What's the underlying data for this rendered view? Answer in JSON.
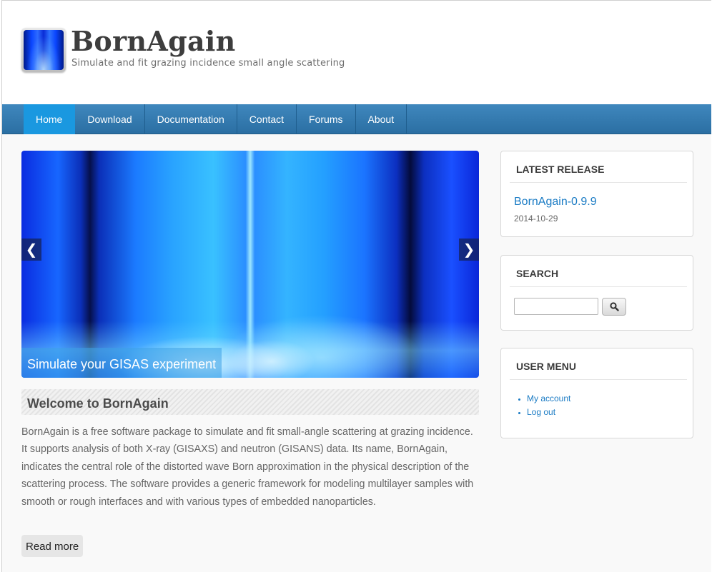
{
  "site": {
    "name": "BornAgain",
    "slogan": "Simulate and fit grazing incidence small angle scattering"
  },
  "nav": {
    "items": [
      "Home",
      "Download",
      "Documentation",
      "Contact",
      "Forums",
      "About"
    ],
    "active": "Home"
  },
  "slider": {
    "caption": "Simulate your GISAS experiment",
    "prev_icon": "chevron-left-icon",
    "next_icon": "chevron-right-icon"
  },
  "article": {
    "title": "Welcome to BornAgain",
    "body": "BornAgain is a free software package to simulate and fit small-angle scattering at grazing incidence. It supports analysis of both X-ray (GISAXS) and neutron (GISANS) data.  Its name, BornAgain, indicates the central role of the distorted wave Born approximation  in the physical description of the scattering process.  The software provides a generic framework for modeling multilayer samples with smooth or rough interfaces and with various types of embedded nanoparticles.",
    "read_more": "Read more"
  },
  "sidebar": {
    "latest_release": {
      "title": "LATEST RELEASE",
      "link": "BornAgain-0.9.9",
      "date": "2014-10-29"
    },
    "search": {
      "title": "SEARCH",
      "value": "",
      "button_icon": "search-icon"
    },
    "user_menu": {
      "title": "USER MENU",
      "items": [
        "My account",
        "Log out"
      ]
    }
  },
  "colors": {
    "nav_bar": "#2f77ad",
    "nav_active": "#1a98e0",
    "link": "#1a7bc4"
  }
}
